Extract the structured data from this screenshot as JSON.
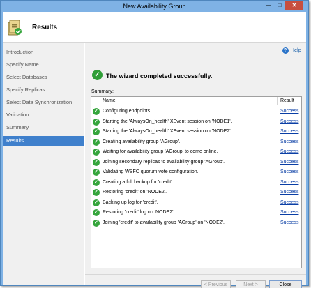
{
  "window": {
    "title": "New Availability Group",
    "minimize_glyph": "—",
    "maximize_glyph": "□",
    "close_glyph": "✕"
  },
  "header": {
    "title": "Results",
    "icon": "wizard-results-icon"
  },
  "sidebar": {
    "items": [
      {
        "label": "Introduction",
        "active": false
      },
      {
        "label": "Specify Name",
        "active": false
      },
      {
        "label": "Select Databases",
        "active": false
      },
      {
        "label": "Specify Replicas",
        "active": false
      },
      {
        "label": "Select Data Synchronization",
        "active": false
      },
      {
        "label": "Validation",
        "active": false
      },
      {
        "label": "Summary",
        "active": false
      },
      {
        "label": "Results",
        "active": true
      }
    ]
  },
  "main": {
    "help_label": "Help",
    "help_glyph": "?",
    "status_glyph": "✓",
    "status_text": "The wizard completed successfully.",
    "summary_label": "Summary:",
    "table": {
      "columns": [
        "Name",
        "Result"
      ],
      "rows": [
        {
          "name": "Configuring endpoints.",
          "result": "Success"
        },
        {
          "name": "Starting the 'AlwaysOn_health' XEvent session on 'NODE1'.",
          "result": "Success"
        },
        {
          "name": "Starting the 'AlwaysOn_health' XEvent session on 'NODE2'.",
          "result": "Success"
        },
        {
          "name": "Creating availability group 'AGroup'.",
          "result": "Success"
        },
        {
          "name": "Waiting for availability group 'AGroup' to come online.",
          "result": "Success"
        },
        {
          "name": "Joining secondary replicas to availability group 'AGroup'.",
          "result": "Success"
        },
        {
          "name": "Validating WSFC quorum vote configuration.",
          "result": "Success"
        },
        {
          "name": "Creating a full backup for 'credit'.",
          "result": "Success"
        },
        {
          "name": "Restoring 'credit' on 'NODE2'.",
          "result": "Success"
        },
        {
          "name": "Backing up log for 'credit'.",
          "result": "Success"
        },
        {
          "name": "Restoring 'credit' log on 'NODE2'.",
          "result": "Success"
        },
        {
          "name": "Joining 'credit' to availability group 'AGroup' on 'NODE2'.",
          "result": "Success"
        }
      ]
    }
  },
  "footer": {
    "previous_label": "< Previous",
    "next_label": "Next >",
    "close_label": "Close"
  },
  "colors": {
    "titlebar": "#7fb2e5",
    "active_nav": "#3f80cc",
    "success_green": "#35a53c",
    "link_blue": "#0a3ea5",
    "close_button": "#c74f3f"
  }
}
